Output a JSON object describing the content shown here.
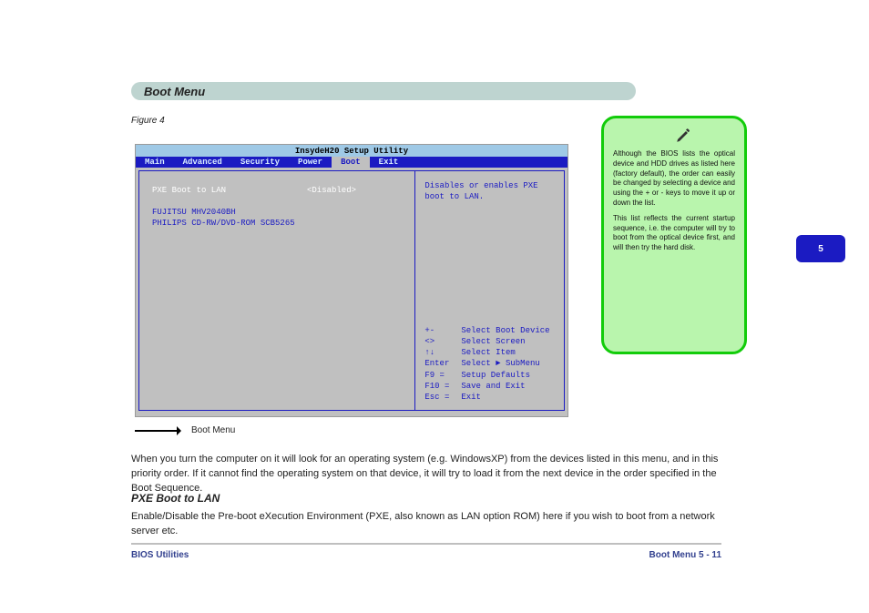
{
  "heading": "Boot Menu",
  "figure_caption": "Figure 4",
  "sidetab": "5",
  "bios": {
    "title": "InsydeH20 Setup Utility",
    "tabs": [
      "Main",
      "Advanced",
      "Security",
      "Power",
      "Boot",
      "Exit"
    ],
    "active_tab_index": 4,
    "setting": {
      "label": "PXE Boot to LAN",
      "value": "<Disabled>"
    },
    "devices": [
      "FUJITSU MHV2040BH",
      "PHILIPS CD-RW/DVD-ROM SCB5265"
    ],
    "help_top": [
      "Disables or enables PXE",
      "boot to LAN."
    ],
    "keys": [
      {
        "k": "+-",
        "d": "Select Boot Device"
      },
      {
        "k": "<>",
        "d": "Select Screen"
      },
      {
        "k": "↑↓",
        "d": "Select Item"
      },
      {
        "k": "Enter",
        "d": "Select ► SubMenu"
      },
      {
        "k": "F9 =",
        "d": "Setup Defaults"
      },
      {
        "k": "F10 =",
        "d": "Save and Exit"
      },
      {
        "k": "Esc =",
        "d": "Exit"
      }
    ]
  },
  "arrow_caption": "Boot Menu",
  "note": {
    "p1": "Although the BIOS lists the optical device and HDD drives as listed here (factory default), the order can easily be changed by selecting a device and using the + or - keys to move it up or down the list.",
    "p2": "This list reflects the current startup sequence, i.e. the computer will try to boot from the optical device first, and will then try the hard disk."
  },
  "para1": "When you turn the computer on it will look for an operating system (e.g. WindowsXP) from the devices listed in this menu, and in this priority order. If it cannot find the operating system on that device, it will try to load it from the next device in the order specified in the Boot Sequence.",
  "subhead": "PXE Boot to LAN",
  "para2": "Enable/Disable the Pre-boot eXecution Environment (PXE, also known as LAN option ROM) here if you wish to boot from a network server etc.",
  "footer": {
    "left": "BIOS Utilities",
    "right": "Boot Menu 5 - 11"
  }
}
